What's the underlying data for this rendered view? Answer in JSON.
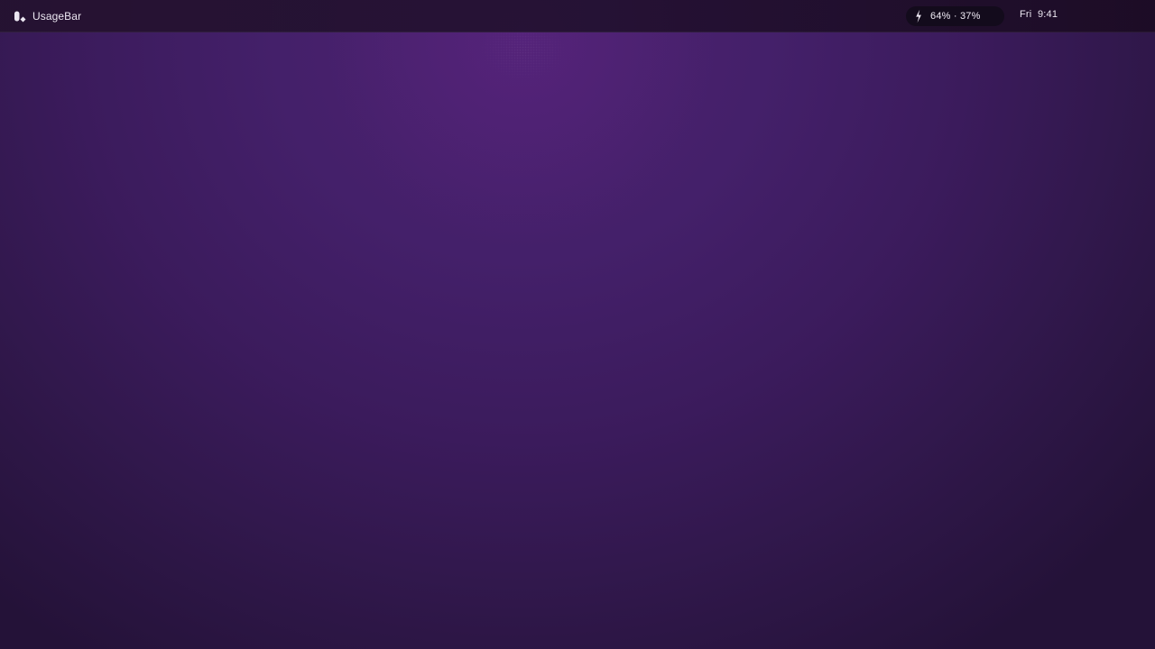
{
  "menubar": {
    "app_name": "UsageBar",
    "app_icon": "usagebar-app-icon",
    "usage": {
      "icon": "lightning-bolt-icon",
      "text": "64% · 37%"
    },
    "clock": {
      "text": "Fri  9:41"
    }
  },
  "colors": {
    "wallpaper_top": "#4e2270",
    "wallpaper_bottom": "#241238",
    "menubar_bg": "#22102e",
    "pill_bg": "#130b1c",
    "text": "#ece7f2"
  }
}
